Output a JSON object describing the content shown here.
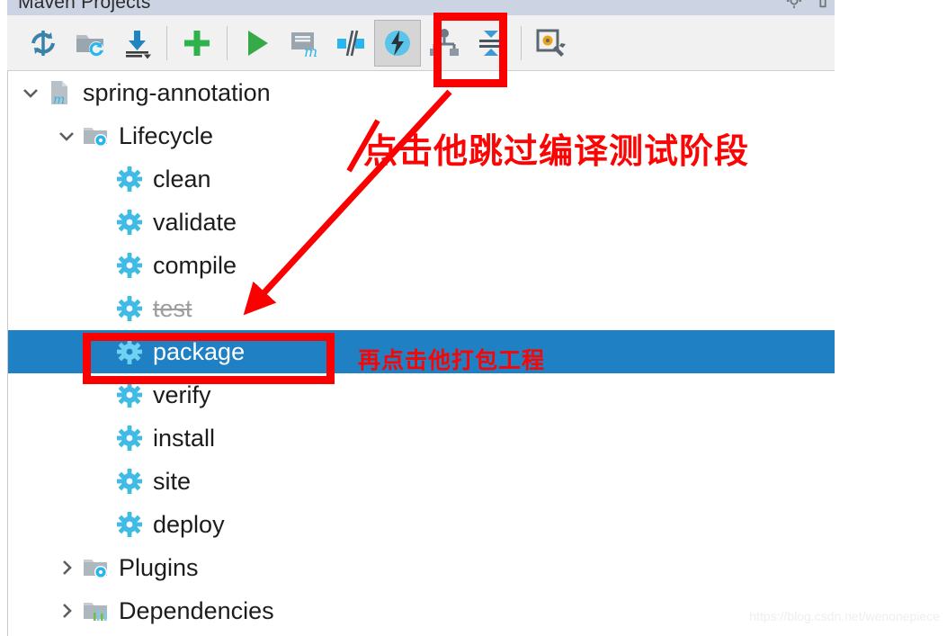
{
  "window": {
    "title": "Maven Projects",
    "titlebar_icons": [
      "settings-gear-icon",
      "collapse-window-icon"
    ]
  },
  "toolbar": {
    "buttons": [
      {
        "name": "reimport-all-maven-projects",
        "icon": "refresh-sync-icon"
      },
      {
        "name": "generate-sources-and-update-folders",
        "icon": "folder-refresh-icon"
      },
      {
        "name": "download-sources-and-documentation",
        "icon": "download-icon"
      },
      {
        "name": "add-maven-projects",
        "icon": "plus-icon"
      },
      {
        "name": "run-maven-build",
        "icon": "play-icon"
      },
      {
        "name": "execute-maven-goal",
        "icon": "m-console-icon"
      },
      {
        "name": "toggle-offline-mode",
        "icon": "offline-icon"
      },
      {
        "name": "skip-tests",
        "icon": "lightning-bolt-icon",
        "active": true
      },
      {
        "name": "show-dependencies",
        "icon": "hierarchy-tree-icon"
      },
      {
        "name": "collapse-all",
        "icon": "collapse-all-icon"
      },
      {
        "name": "maven-settings",
        "icon": "settings-wrench-icon"
      }
    ]
  },
  "tree": {
    "nodes": [
      {
        "label": "spring-annotation",
        "level": 0,
        "icon": "maven-module-icon",
        "expander": "expanded",
        "state": "normal"
      },
      {
        "label": "Lifecycle",
        "level": 1,
        "icon": "folder-gear-icon",
        "expander": "expanded",
        "state": "normal"
      },
      {
        "label": "clean",
        "level": 2,
        "icon": "gear-icon",
        "expander": "none",
        "state": "normal"
      },
      {
        "label": "validate",
        "level": 2,
        "icon": "gear-icon",
        "expander": "none",
        "state": "normal"
      },
      {
        "label": "compile",
        "level": 2,
        "icon": "gear-icon",
        "expander": "none",
        "state": "normal"
      },
      {
        "label": "test",
        "level": 2,
        "icon": "gear-icon",
        "expander": "none",
        "state": "disabled"
      },
      {
        "label": "package",
        "level": 2,
        "icon": "gear-icon",
        "expander": "none",
        "state": "selected"
      },
      {
        "label": "verify",
        "level": 2,
        "icon": "gear-icon",
        "expander": "none",
        "state": "normal"
      },
      {
        "label": "install",
        "level": 2,
        "icon": "gear-icon",
        "expander": "none",
        "state": "normal"
      },
      {
        "label": "site",
        "level": 2,
        "icon": "gear-icon",
        "expander": "none",
        "state": "normal"
      },
      {
        "label": "deploy",
        "level": 2,
        "icon": "gear-icon",
        "expander": "none",
        "state": "normal"
      },
      {
        "label": "Plugins",
        "level": 1,
        "icon": "folder-gear-icon",
        "expander": "collapsed",
        "state": "normal"
      },
      {
        "label": "Dependencies",
        "level": 1,
        "icon": "folder-bars-icon",
        "expander": "collapsed",
        "state": "normal"
      }
    ]
  },
  "annotations": {
    "note_skip": "点击他跳过编译测试阶段",
    "note_package": "再点击他打包工程",
    "accent_color": "#fb0000",
    "selection_color": "#1f80c4"
  },
  "watermark": "https://blog.csdn.net/wenonepiece"
}
